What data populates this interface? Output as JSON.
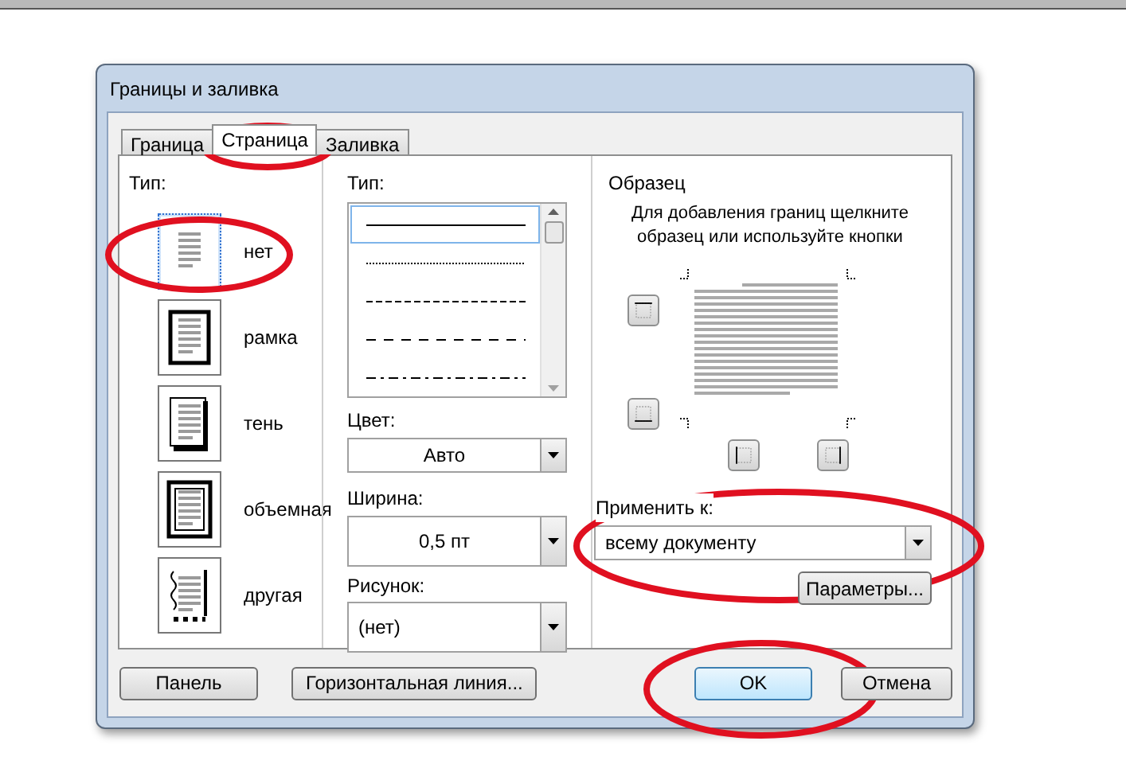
{
  "window": {
    "title": "Границы и заливка"
  },
  "tabs": [
    {
      "label": "Граница",
      "selected": false
    },
    {
      "label": "Страница",
      "selected": true
    },
    {
      "label": "Заливка",
      "selected": false
    }
  ],
  "setting": {
    "label": "Тип:",
    "options": [
      {
        "label": "нет",
        "kind": "none",
        "selected": true
      },
      {
        "label": "рамка",
        "kind": "box",
        "selected": false
      },
      {
        "label": "тень",
        "kind": "shadow",
        "selected": false
      },
      {
        "label": "объемная",
        "kind": "framed",
        "selected": false
      },
      {
        "label": "другая",
        "kind": "custom",
        "selected": false
      }
    ]
  },
  "style": {
    "label": "Тип:",
    "lines": [
      {
        "kind": "solid",
        "selected": true
      },
      {
        "kind": "dotted",
        "selected": false
      },
      {
        "kind": "dashed",
        "selected": false
      },
      {
        "kind": "long-dash",
        "selected": false
      },
      {
        "kind": "dash-dot",
        "selected": false
      }
    ]
  },
  "color": {
    "label": "Цвет:",
    "value": "Авто"
  },
  "width": {
    "label": "Ширина:",
    "value": "0,5 пт"
  },
  "art": {
    "label": "Рисунок:",
    "value": "(нет)"
  },
  "preview": {
    "title": "Образец",
    "hint": "Для добавления границ щелкните образец или используйте кнопки"
  },
  "apply_to": {
    "label": "Применить к:",
    "value": "всему документу"
  },
  "options_button": "Параметры...",
  "buttons": [
    "Панель",
    "Горизонтальная линия...",
    "OK",
    "Отмена"
  ]
}
